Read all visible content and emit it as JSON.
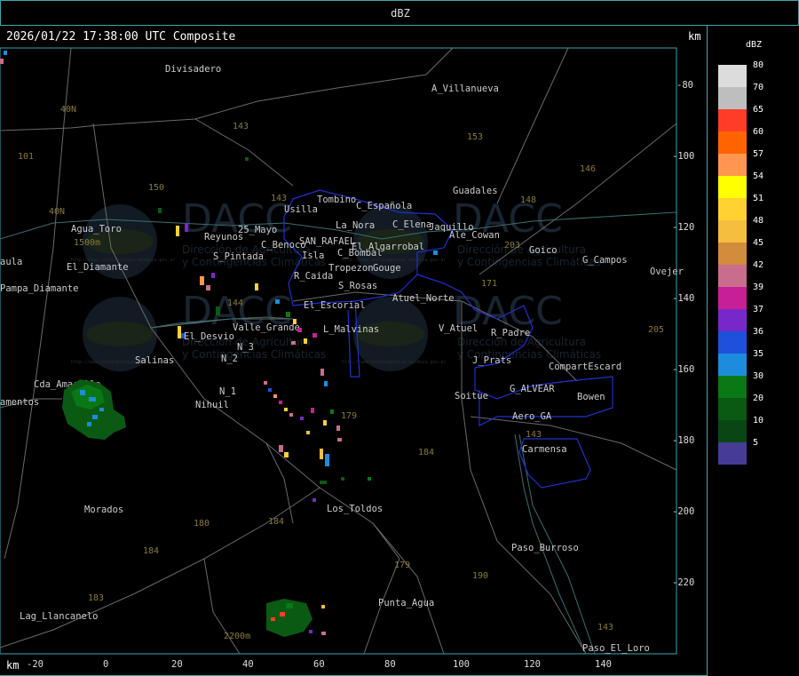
{
  "header": {
    "title": "dBZ"
  },
  "map": {
    "timestamp": "2026/01/22 17:38:00 UTC Composite",
    "unit_top": "km",
    "unit_bottom": "km",
    "x_ticks": [
      "-20",
      "0",
      "20",
      "40",
      "60",
      "80",
      "100",
      "120",
      "140"
    ],
    "y_ticks": [
      "-80",
      "-100",
      "-120",
      "-140",
      "-160",
      "-180",
      "-200",
      "-220"
    ],
    "places": [
      "Divisadero",
      "A_Villanueva",
      "Guadales",
      "Tombino",
      "Usilla",
      "C_Española",
      "La_Nora",
      "C_Elena",
      "Jaquillo",
      "Ale_Cowan",
      "Agua_Toro",
      "Reyunos",
      "25_Mayo",
      "C_Benoco",
      "SAN_RAFAEL",
      "El_Algarrobal",
      "C_Bombal",
      "Goico",
      "G_Campos",
      "Ovejer",
      "aula",
      "El_Diamante",
      "Pampa_Diamante",
      "S_Pintada",
      "Isla",
      "Tropezon",
      "Gouge",
      "R_Caida",
      "S_Rosas",
      "Atuel_Norte",
      "El_Escorial",
      "L_Malvinas",
      "V_Atuel",
      "R_Padre",
      "Valle_Grande",
      "El_Desvio",
      "N_3",
      "N_2",
      "N_1",
      "Nihuil",
      "Salinas",
      "J_Prats",
      "CompartEscard",
      "G_ALVEAR",
      "Bowen",
      "Soitue",
      "Aero_GA",
      "Carmensa",
      "Cda_Amarilla",
      "amentos",
      "Morados",
      "Los_Toldos",
      "Paso_Burroso",
      "Punta_Agua",
      "Lag_Llancanelo",
      "Paso_El_Loro"
    ],
    "roads": [
      "101",
      "40N",
      "40N",
      "143",
      "153",
      "146",
      "150",
      "143",
      "148",
      "203",
      "171",
      "144",
      "179",
      "184",
      "184",
      "180",
      "184",
      "183",
      "190",
      "179",
      "143",
      "143",
      "205"
    ],
    "elevations": [
      "1500m",
      "2200m"
    ],
    "watermark": {
      "brand": "DACC",
      "line1": "Dirección de Agricultura",
      "line2": "y Contingencias Climáticas",
      "url": "http://www.contingencias.mendoza.gov.ar"
    }
  },
  "legend": {
    "title": "dBZ",
    "entries": [
      {
        "label": "80",
        "color": "#dcdcdc"
      },
      {
        "label": "70",
        "color": "#bebebe"
      },
      {
        "label": "65",
        "color": "#ff3c28"
      },
      {
        "label": "60",
        "color": "#ff6400"
      },
      {
        "label": "57",
        "color": "#ff9650"
      },
      {
        "label": "54",
        "color": "#ffff00"
      },
      {
        "label": "51",
        "color": "#ffd232"
      },
      {
        "label": "48",
        "color": "#f5be3c"
      },
      {
        "label": "45",
        "color": "#d28c3c"
      },
      {
        "label": "42",
        "color": "#c86e8c"
      },
      {
        "label": "39",
        "color": "#c81e96"
      },
      {
        "label": "37",
        "color": "#7828c8"
      },
      {
        "label": "36",
        "color": "#1e50dc"
      },
      {
        "label": "35",
        "color": "#1e8cdc"
      },
      {
        "label": "30",
        "color": "#0a7814"
      },
      {
        "label": "20",
        "color": "#0a5a14"
      },
      {
        "label": "10",
        "color": "#0a4614"
      },
      {
        "label": "5",
        "color": "#463c96"
      }
    ]
  }
}
